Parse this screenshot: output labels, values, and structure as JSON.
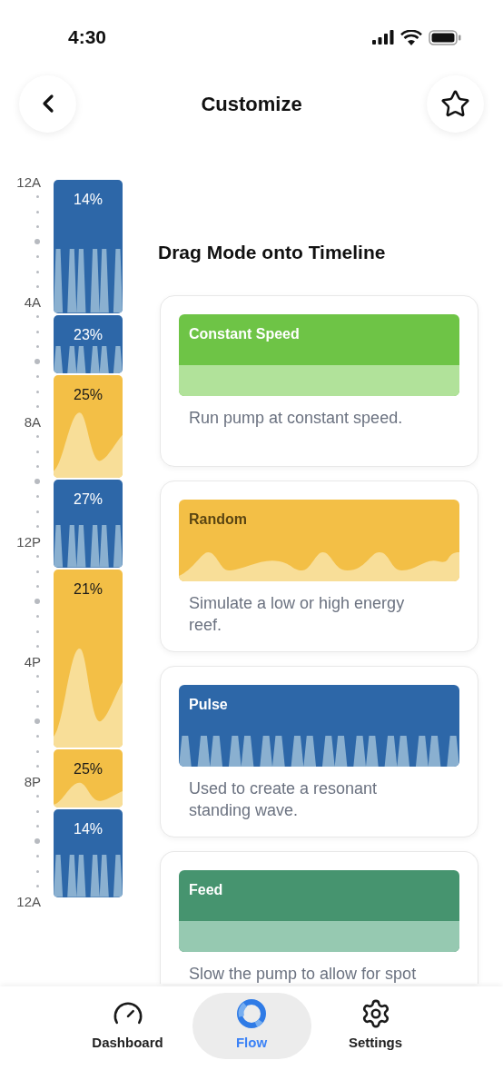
{
  "status_bar": {
    "time": "4:30"
  },
  "header": {
    "title": "Customize"
  },
  "timeline": {
    "hour_labels": [
      "12A",
      "4A",
      "8A",
      "12P",
      "4P",
      "8P",
      "12A"
    ],
    "segments": [
      {
        "kind": "pulse",
        "label": "14%"
      },
      {
        "kind": "pulse",
        "label": "23%"
      },
      {
        "kind": "random",
        "label": "25%"
      },
      {
        "kind": "pulse",
        "label": "27%"
      },
      {
        "kind": "random",
        "label": "21%"
      },
      {
        "kind": "random",
        "label": "25%"
      },
      {
        "kind": "pulse",
        "label": "14%"
      }
    ]
  },
  "modes_heading": "Drag Mode onto Timeline",
  "modes": [
    {
      "kind": "constant",
      "name": "Constant Speed",
      "description": "Run pump at constant speed."
    },
    {
      "kind": "random",
      "name": "Random",
      "description": "Simulate a low or high energy reef."
    },
    {
      "kind": "pulse",
      "name": "Pulse",
      "description": "Used to create a resonant standing wave."
    },
    {
      "kind": "feed",
      "name": "Feed",
      "description": "Slow the pump to allow for spot"
    }
  ],
  "tab_bar": [
    {
      "kind": "dashboard",
      "label": "Dashboard",
      "selected": false
    },
    {
      "kind": "flow",
      "label": "Flow",
      "selected": true
    },
    {
      "kind": "settings",
      "label": "Settings",
      "selected": false
    }
  ]
}
